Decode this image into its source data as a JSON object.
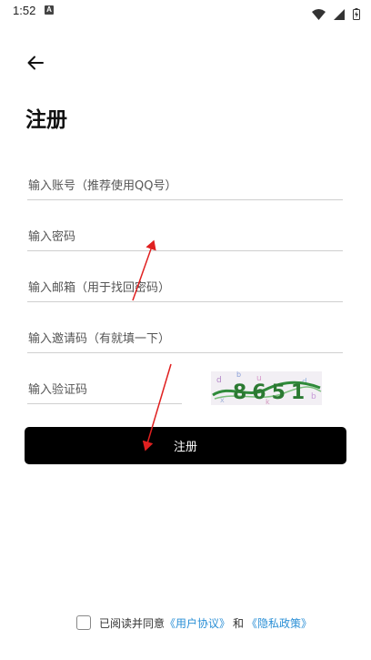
{
  "status_bar": {
    "time": "1:52",
    "notification_badge": "A"
  },
  "header": {
    "back_icon": "arrow-left-icon",
    "title": "注册"
  },
  "form": {
    "account_placeholder": "输入账号（推荐使用QQ号）",
    "password_placeholder": "输入密码",
    "email_placeholder": "输入邮箱（用于找回密码）",
    "invite_placeholder": "输入邀请码（有就填一下）",
    "captcha_placeholder": "输入验证码",
    "captcha_text": "8651"
  },
  "register_button_label": "注册",
  "agreement": {
    "prefix": "已阅读并同意",
    "user_agreement": "《用户协议》",
    "conjunction": "和",
    "privacy_policy": "《隐私政策》"
  },
  "colors": {
    "button_bg": "#000000",
    "link": "#2a8fd6",
    "annotation_arrow": "#e02020"
  }
}
